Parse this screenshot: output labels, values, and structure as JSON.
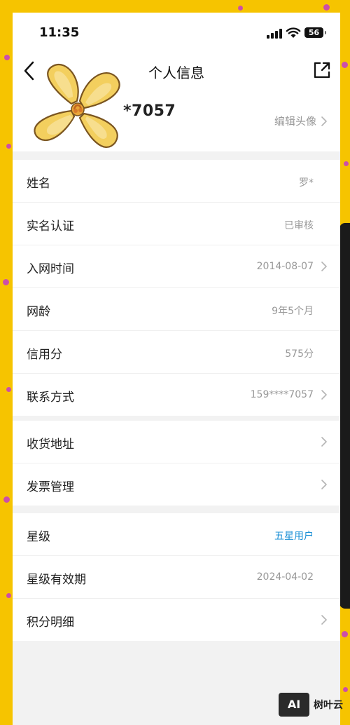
{
  "status_bar": {
    "time": "11:35",
    "battery": "56"
  },
  "nav": {
    "title": "个人信息"
  },
  "profile": {
    "masked_number": "*7057",
    "edit_avatar_label": "编辑头像"
  },
  "groups": [
    {
      "rows": [
        {
          "label": "姓名",
          "value": "罗*",
          "chevron": false
        },
        {
          "label": "实名认证",
          "value": "已审核",
          "chevron": false
        },
        {
          "label": "入网时间",
          "value": "2014-08-07",
          "chevron": true
        },
        {
          "label": "网龄",
          "value": "9年5个月",
          "chevron": false
        },
        {
          "label": "信用分",
          "value": "575分",
          "chevron": false
        },
        {
          "label": "联系方式",
          "value": "159****7057",
          "chevron": true
        }
      ]
    },
    {
      "rows": [
        {
          "label": "收货地址",
          "value": "",
          "chevron": true
        },
        {
          "label": "发票管理",
          "value": "",
          "chevron": true
        }
      ]
    },
    {
      "rows": [
        {
          "label": "星级",
          "value": "五星用户",
          "chevron": false,
          "accent": "#1a8fd6"
        },
        {
          "label": "星级有效期",
          "value": "2024-04-02",
          "chevron": false
        },
        {
          "label": "积分明细",
          "value": "",
          "chevron": true
        }
      ]
    }
  ],
  "watermark": {
    "logo_text": "AI",
    "text": "树叶云"
  },
  "colors": {
    "background": "#f6c400",
    "dots": "#c43bc5",
    "accent": "#1a8fd6"
  },
  "icons": {
    "back": "chevron-left-icon",
    "share": "share-icon",
    "row_chevron": "chevron-right-icon",
    "avatar": "flower-avatar"
  }
}
